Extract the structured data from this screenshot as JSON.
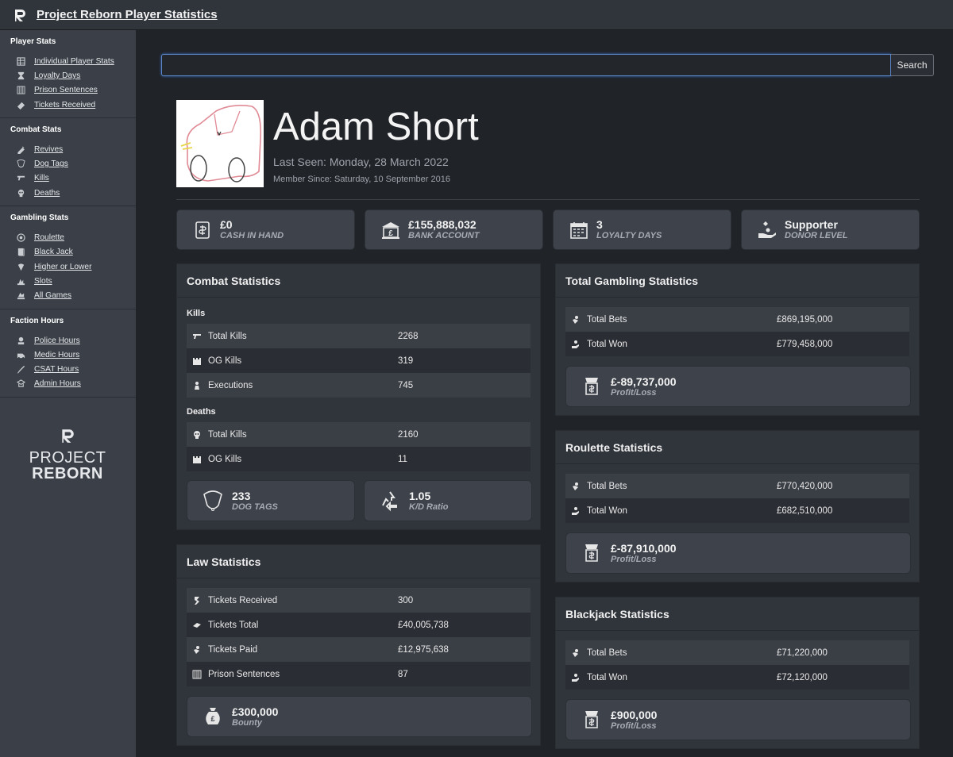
{
  "header": {
    "title": "Project Reborn Player Statistics"
  },
  "sidebar": {
    "sections": [
      {
        "title": "Player Stats",
        "items": [
          {
            "label": "Individual Player Stats",
            "icon": "table-icon"
          },
          {
            "label": "Loyalty Days",
            "icon": "hourglass-icon"
          },
          {
            "label": "Prison Sentences",
            "icon": "bars-icon"
          },
          {
            "label": "Tickets Received",
            "icon": "ticket-icon"
          }
        ]
      },
      {
        "title": "Combat Stats",
        "items": [
          {
            "label": "Revives",
            "icon": "syringe-icon"
          },
          {
            "label": "Dog Tags",
            "icon": "dogtag-icon"
          },
          {
            "label": "Kills",
            "icon": "gun-icon"
          },
          {
            "label": "Deaths",
            "icon": "skull-icon"
          }
        ]
      },
      {
        "title": "Gambling Stats",
        "items": [
          {
            "label": "Roulette",
            "icon": "roulette-icon"
          },
          {
            "label": "Black Jack",
            "icon": "cards-icon"
          },
          {
            "label": "Higher or Lower",
            "icon": "dice-icon"
          },
          {
            "label": "Slots",
            "icon": "slots-icon"
          },
          {
            "label": "All Games",
            "icon": "coins-icon"
          }
        ]
      },
      {
        "title": "Faction Hours",
        "items": [
          {
            "label": "Police Hours",
            "icon": "police-icon"
          },
          {
            "label": "Medic Hours",
            "icon": "ambulance-icon"
          },
          {
            "label": "CSAT Hours",
            "icon": "knife-icon"
          },
          {
            "label": "Admin Hours",
            "icon": "admin-icon"
          }
        ]
      }
    ],
    "brand": {
      "line1": "PROJECT",
      "line2": "REBORN"
    }
  },
  "search": {
    "value": "",
    "button_label": "Search"
  },
  "profile": {
    "name": "Adam Short",
    "last_seen": "Last Seen: Monday, 28 March 2022",
    "member_since": "Member Since: Saturday, 10 September 2016"
  },
  "summary_cards": [
    {
      "value": "£0",
      "label": "CASH IN HAND",
      "icon": "cash-icon"
    },
    {
      "value": "£155,888,032",
      "label": "BANK ACCOUNT",
      "icon": "bank-icon"
    },
    {
      "value": "3",
      "label": "LOYALTY DAYS",
      "icon": "calendar-icon"
    },
    {
      "value": "Supporter",
      "label": "DONOR LEVEL",
      "icon": "donate-icon"
    }
  ],
  "combat": {
    "title": "Combat Statistics",
    "kills_heading": "Kills",
    "kills": [
      {
        "label": "Total Kills",
        "value": "2268",
        "icon": "gun-icon"
      },
      {
        "label": "OG Kills",
        "value": "319",
        "icon": "castle-icon"
      },
      {
        "label": "Executions",
        "value": "745",
        "icon": "execution-icon"
      }
    ],
    "deaths_heading": "Deaths",
    "deaths": [
      {
        "label": "Total Kills",
        "value": "2160",
        "icon": "skull-icon"
      },
      {
        "label": "OG Kills",
        "value": "11",
        "icon": "castle-icon"
      }
    ],
    "dog_tags": {
      "value": "233",
      "label": "DOG TAGS"
    },
    "kd": {
      "value": "1.05",
      "label": "K/D Ratio"
    }
  },
  "law": {
    "title": "Law Statistics",
    "rows": [
      {
        "label": "Tickets Received",
        "value": "300",
        "icon": "ticket-icon"
      },
      {
        "label": "Tickets Total",
        "value": "£40,005,738",
        "icon": "money-icon"
      },
      {
        "label": "Tickets Paid",
        "value": "£12,975,638",
        "icon": "hand-coin-icon"
      },
      {
        "label": "Prison Sentences",
        "value": "87",
        "icon": "bars-icon"
      }
    ],
    "bounty": {
      "value": "£300,000",
      "label": "Bounty"
    }
  },
  "total_gambling": {
    "title": "Total Gambling Statistics",
    "rows": [
      {
        "label": "Total Bets",
        "value": "£869,195,000",
        "icon": "hand-coin-icon"
      },
      {
        "label": "Total Won",
        "value": "£779,458,000",
        "icon": "hand-money-icon"
      }
    ],
    "profit": {
      "value": "£-89,737,000",
      "label": "Profit/Loss"
    }
  },
  "roulette": {
    "title": "Roulette Statistics",
    "rows": [
      {
        "label": "Total Bets",
        "value": "£770,420,000",
        "icon": "hand-coin-icon"
      },
      {
        "label": "Total Won",
        "value": "£682,510,000",
        "icon": "hand-money-icon"
      }
    ],
    "profit": {
      "value": "£-87,910,000",
      "label": "Profit/Loss"
    }
  },
  "blackjack": {
    "title": "Blackjack Statistics",
    "rows": [
      {
        "label": "Total Bets",
        "value": "£71,220,000",
        "icon": "hand-coin-icon"
      },
      {
        "label": "Total Won",
        "value": "£72,120,000",
        "icon": "hand-money-icon"
      }
    ],
    "profit": {
      "value": "£900,000",
      "label": "Profit/Loss"
    }
  }
}
